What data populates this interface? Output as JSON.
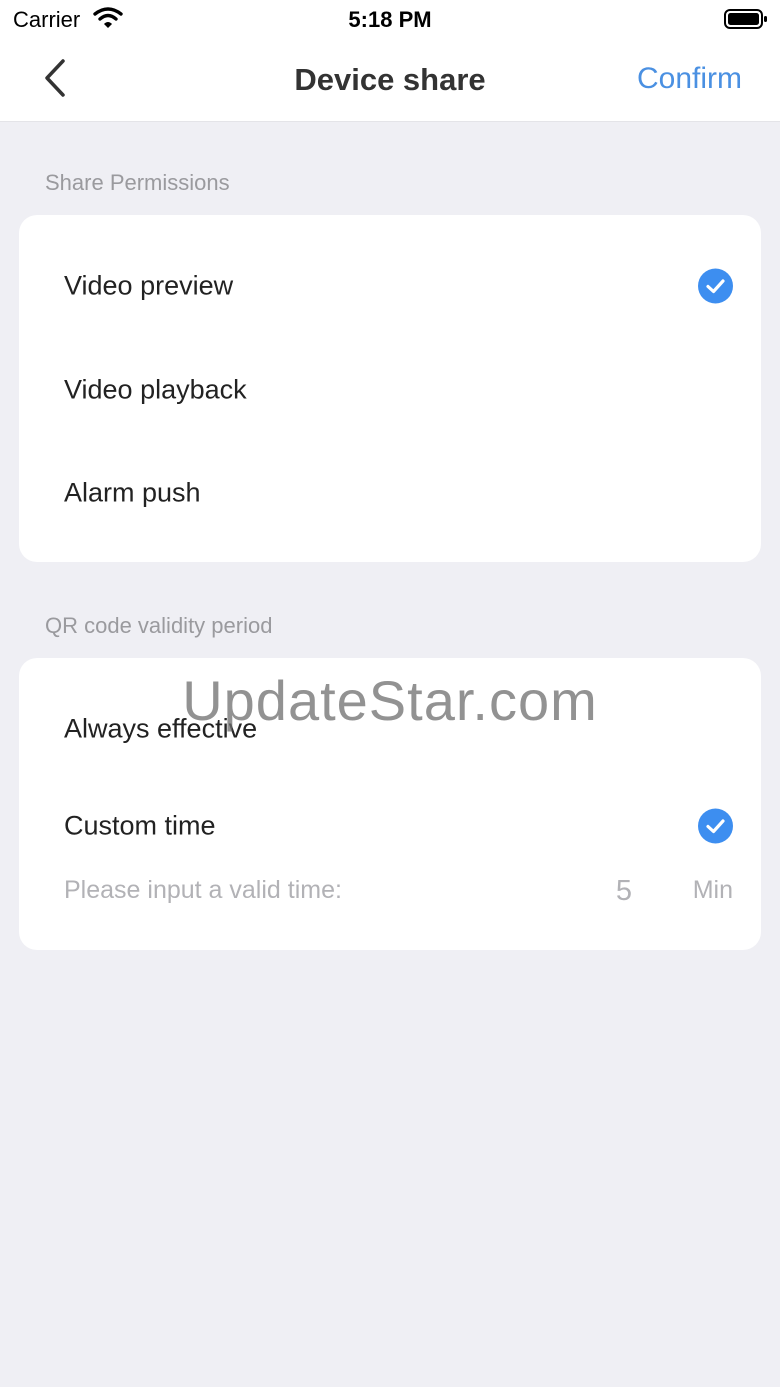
{
  "status_bar": {
    "carrier": "Carrier",
    "time": "5:18 PM"
  },
  "nav": {
    "title": "Device share",
    "confirm_label": "Confirm"
  },
  "share_permissions": {
    "section_label": "Share Permissions",
    "items": [
      {
        "label": "Video preview",
        "checked": true
      },
      {
        "label": "Video playback",
        "checked": false
      },
      {
        "label": "Alarm push",
        "checked": false
      }
    ]
  },
  "validity": {
    "section_label": "QR code validity period",
    "options": [
      {
        "label": "Always effective",
        "checked": false
      },
      {
        "label": "Custom time",
        "checked": true
      }
    ],
    "custom_time": {
      "prompt": "Please input a valid time:",
      "value": "5",
      "unit": "Min"
    }
  },
  "watermark": "UpdateStar.com",
  "colors": {
    "accent": "#4a90e2",
    "check": "#3d8ef0",
    "background": "#efeff4"
  }
}
